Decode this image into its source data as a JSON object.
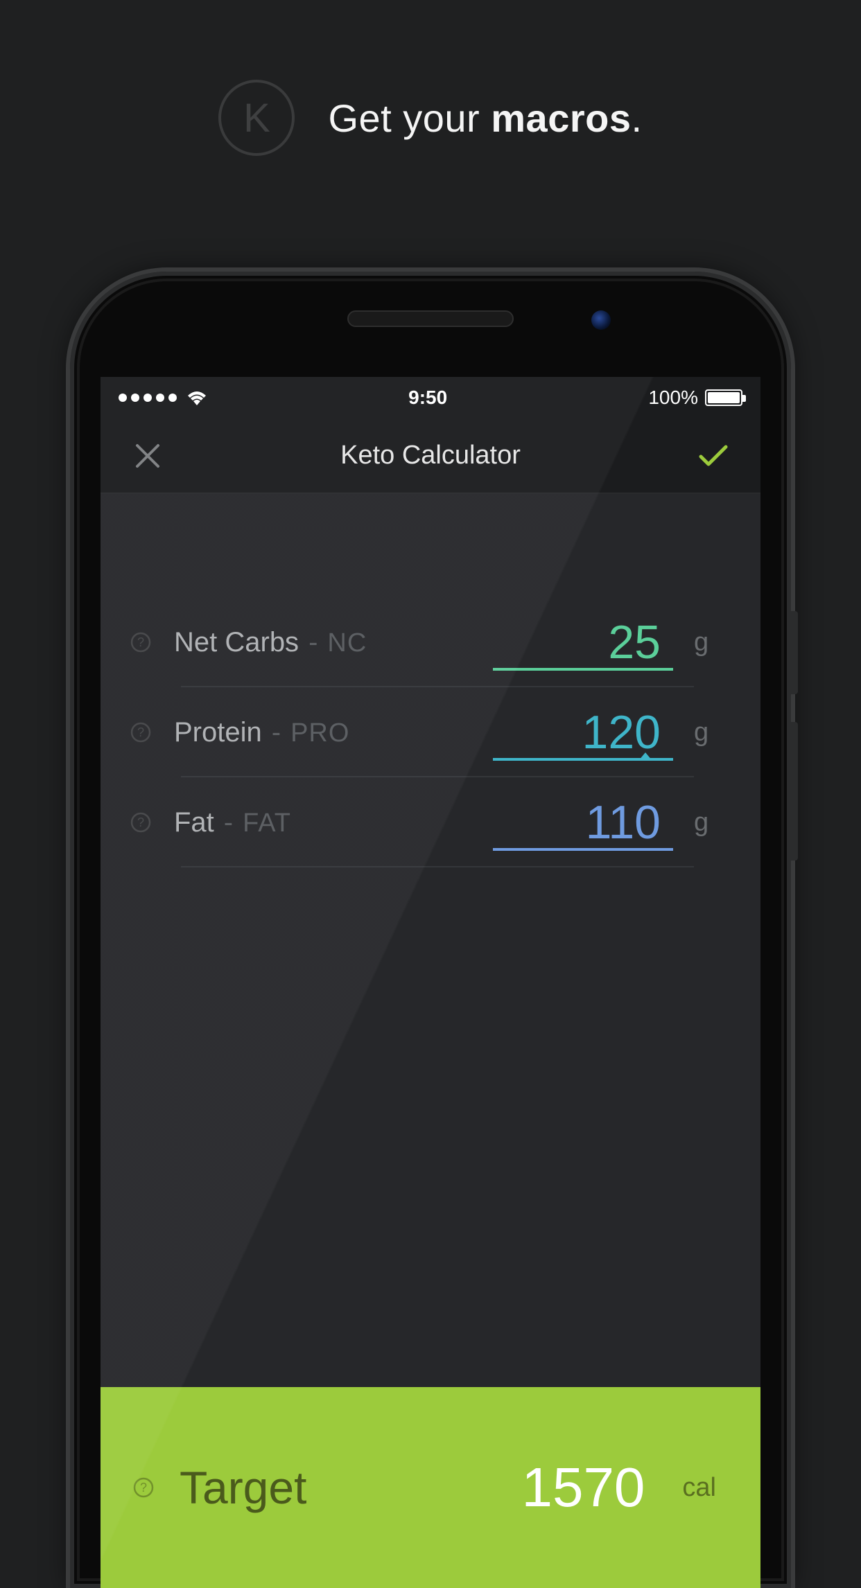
{
  "header": {
    "logo_letter": "K",
    "tagline_pre": "Get your ",
    "tagline_bold": "macros",
    "tagline_post": "."
  },
  "status": {
    "time": "9:50",
    "battery_pct": "100%"
  },
  "nav": {
    "title": "Keto Calculator"
  },
  "macros": [
    {
      "label": "Net Carbs",
      "abbr": "NC",
      "value": "25",
      "unit": "g",
      "color": "carbs"
    },
    {
      "label": "Protein",
      "abbr": "PRO",
      "value": "120",
      "unit": "g",
      "color": "protein",
      "indicator": true
    },
    {
      "label": "Fat",
      "abbr": "FAT",
      "value": "110",
      "unit": "g",
      "color": "fat"
    }
  ],
  "target": {
    "label": "Target",
    "value": "1570",
    "unit": "cal"
  },
  "chart_data": {
    "type": "table",
    "title": "Keto Calculator Macros",
    "rows": [
      {
        "macro": "Net Carbs",
        "grams": 25
      },
      {
        "macro": "Protein",
        "grams": 120
      },
      {
        "macro": "Fat",
        "grams": 110
      }
    ],
    "target_calories": 1570
  }
}
